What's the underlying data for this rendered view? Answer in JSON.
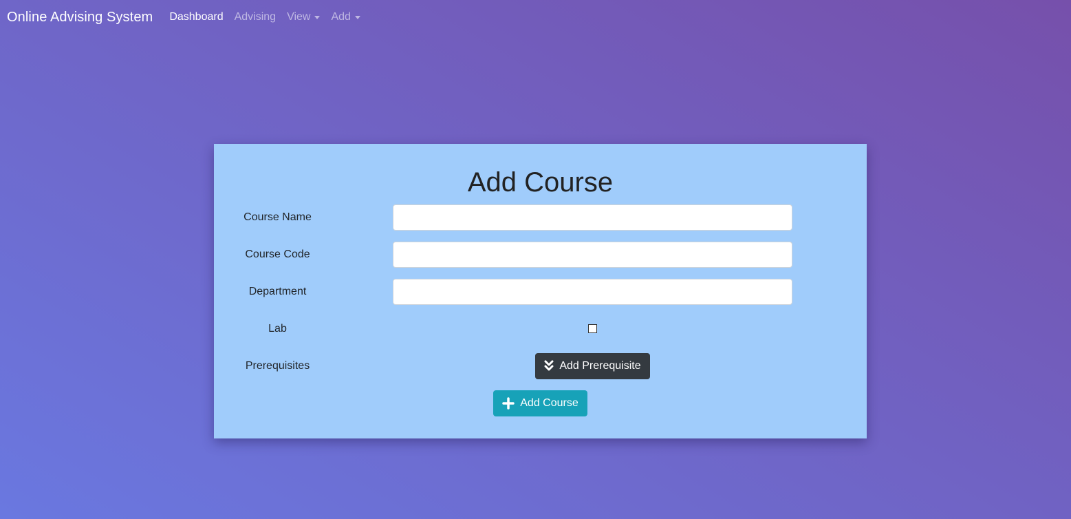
{
  "navbar": {
    "brand": "Online Advising System",
    "links": [
      {
        "label": "Dashboard"
      },
      {
        "label": "Advising"
      },
      {
        "label": "View"
      },
      {
        "label": "Add"
      }
    ]
  },
  "form": {
    "title": "Add Course",
    "fields": {
      "course_name": {
        "label": "Course Name",
        "value": "",
        "placeholder": ""
      },
      "course_code": {
        "label": "Course Code",
        "value": "",
        "placeholder": ""
      },
      "department": {
        "label": "Department",
        "value": "",
        "placeholder": ""
      },
      "lab": {
        "label": "Lab",
        "checked": false
      },
      "prerequisites": {
        "label": "Prerequisites"
      }
    },
    "add_prerequisite_label": "Add Prerequisite",
    "add_course_label": "Add Course"
  },
  "icons": {
    "add_prerequisite": "chevron-double-down-icon",
    "add_course": "plus-icon"
  },
  "colors": {
    "card_background": "#a0ccfb",
    "dark_button": "#343a40",
    "info_button": "#17a2b8"
  }
}
